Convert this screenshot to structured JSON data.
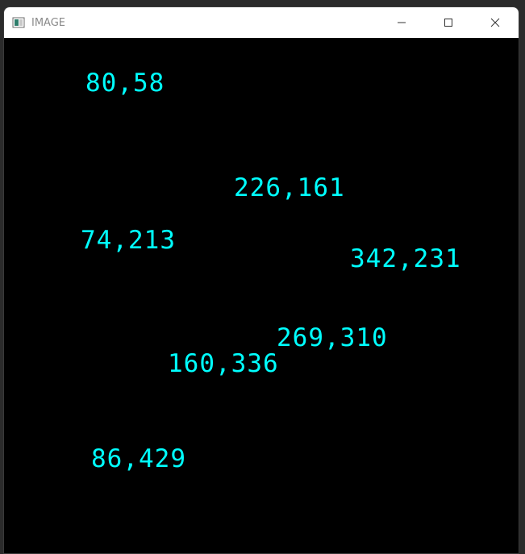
{
  "window": {
    "title": "IMAGE",
    "icon": "image-window-icon",
    "controls": [
      "minimize-icon",
      "maximize-icon",
      "close-icon"
    ]
  },
  "canvas": {
    "background_color": "#000000",
    "text_color": "#00ffff",
    "labels": [
      "80,58",
      "226,161",
      "74,213",
      "342,231",
      "269,310",
      "160,336",
      "86,429"
    ]
  }
}
